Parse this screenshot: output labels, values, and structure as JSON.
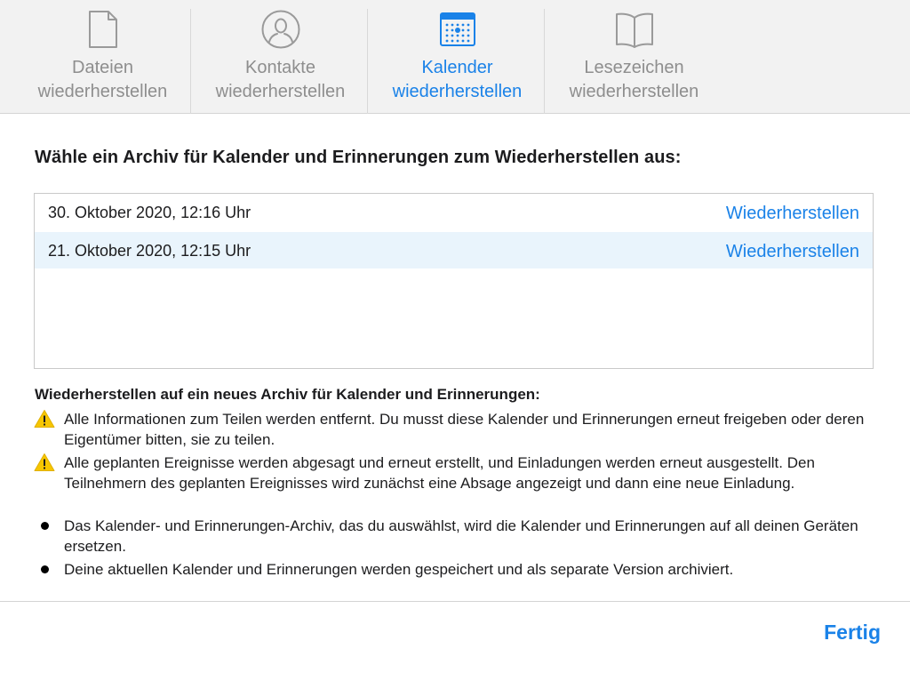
{
  "tabs": [
    {
      "icon": "document-icon",
      "line1": "Dateien",
      "line2": "wiederherstellen",
      "active": false
    },
    {
      "icon": "contact-icon",
      "line1": "Kontakte",
      "line2": "wiederherstellen",
      "active": false
    },
    {
      "icon": "calendar-icon",
      "line1": "Kalender",
      "line2": "wiederherstellen",
      "active": true
    },
    {
      "icon": "bookmark-icon",
      "line1": "Lesezeichen",
      "line2": "wiederherstellen",
      "active": false
    }
  ],
  "heading": "Wähle ein Archiv für Kalender und Erinnerungen zum Wiederherstellen aus:",
  "archives": [
    {
      "date": "30. Oktober 2020, 12:16 Uhr",
      "action": "Wiederherstellen",
      "selected": false
    },
    {
      "date": "21. Oktober 2020, 12:15 Uhr",
      "action": "Wiederherstellen",
      "selected": true
    }
  ],
  "info": {
    "title": "Wiederherstellen auf ein neues Archiv für Kalender und Erinnerungen:",
    "items": [
      {
        "marker": "warning-icon",
        "text": "Alle Informationen zum Teilen werden entfernt. Du musst diese Kalender und Erinnerungen erneut freigeben oder deren Eigentümer bitten, sie zu teilen."
      },
      {
        "marker": "warning-icon",
        "text": "Alle geplanten Ereignisse werden abgesagt und erneut erstellt, und Einladungen werden erneut ausgestellt. Den Teilnehmern des geplanten Ereignisses wird zunächst eine Absage angezeigt und dann eine neue Einladung."
      },
      {
        "marker": "bullet",
        "text": "Das Kalender- und Erinnerungen-Archiv, das du auswählst, wird die Kalender und Erinnerungen auf all deinen Geräten ersetzen."
      },
      {
        "marker": "bullet",
        "text": "Deine aktuellen Kalender und Erinnerungen werden gespeichert und als separate Version archiviert."
      }
    ]
  },
  "footer": {
    "done_label": "Fertig"
  },
  "colors": {
    "accent": "#1a82e8",
    "inactive": "#8e8e8e",
    "warning": "#f7c600",
    "selected_row": "#e9f4fc"
  }
}
